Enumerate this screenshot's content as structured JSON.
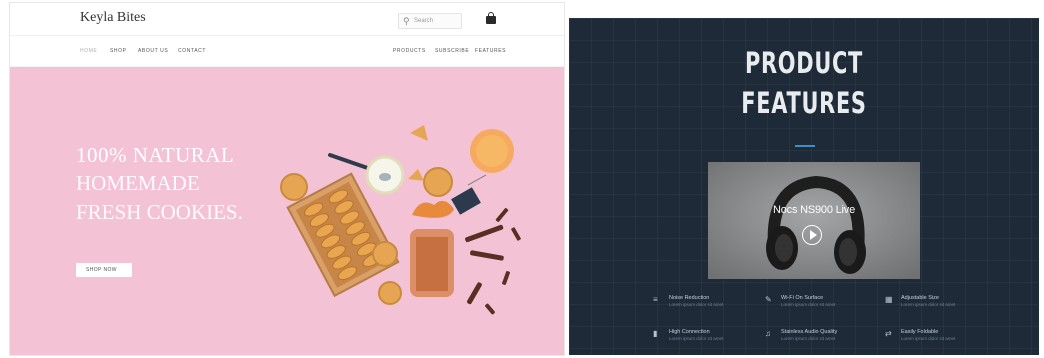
{
  "left_site": {
    "brand": "Keyla Bites",
    "search_placeholder": "Search",
    "nav": {
      "primary": [
        "Home",
        "Shop",
        "About Us",
        "Contact"
      ],
      "secondary": [
        "Products",
        "Subscribe",
        "Features"
      ]
    },
    "hero": {
      "line1": "100% NATURAL",
      "line2": "HOMEMADE",
      "line3": "FRESH COOKIES.",
      "button": "SHOP NOW"
    },
    "colors": {
      "hero_bg": "#f3c3d5",
      "accent": "#ffffff"
    },
    "icons": [
      "search-icon",
      "shopping-bag-icon"
    ]
  },
  "right_site": {
    "title_line1": "PRODUCT",
    "title_line2": "FEATURES",
    "video_label": "Nocs NS900 Live",
    "features": [
      {
        "title": "Noise Reduction",
        "subtitle": "Lorem ipsum dolor sit amet",
        "icon": "waveform-icon"
      },
      {
        "title": "Wi-Fi On Surface",
        "subtitle": "Lorem ipsum dolor sit amet",
        "icon": "pen-icon"
      },
      {
        "title": "Adjustable Size",
        "subtitle": "Lorem ipsum dolor sit amet",
        "icon": "grid-icon"
      },
      {
        "title": "High Connection",
        "subtitle": "Lorem ipsum dolor sit amet",
        "icon": "battery-icon"
      },
      {
        "title": "Stainless Audio Quality",
        "subtitle": "Lorem ipsum dolor sit amet",
        "icon": "music-note-icon"
      },
      {
        "title": "Easily Foldable",
        "subtitle": "Lorem ipsum dolor sit amet",
        "icon": "fold-icon"
      }
    ],
    "colors": {
      "bg": "#1e2a37",
      "accent": "#3e8ec7"
    },
    "icons": [
      "play-icon"
    ]
  }
}
